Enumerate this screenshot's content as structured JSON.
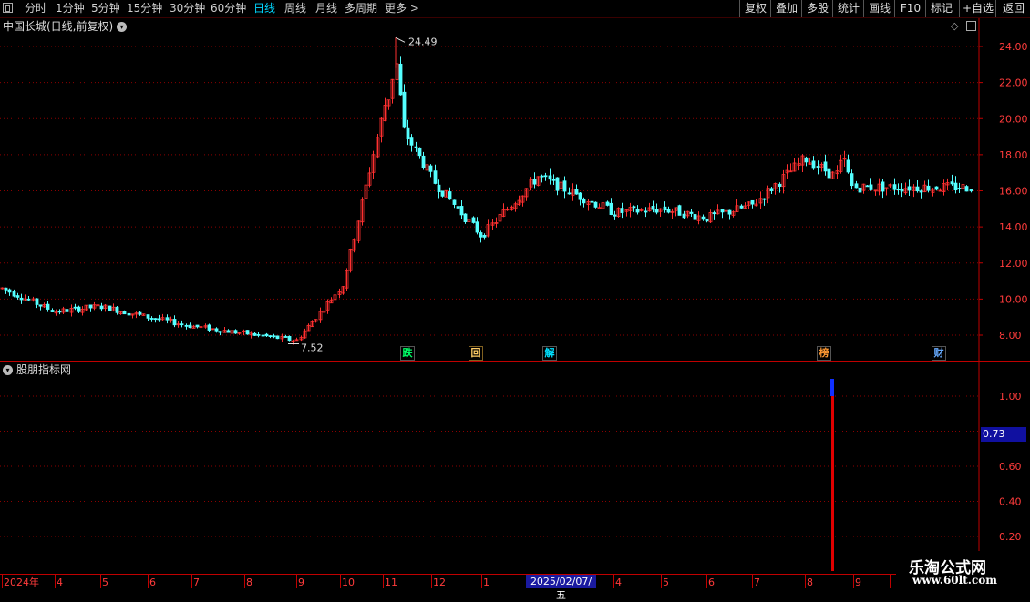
{
  "toolbar": {
    "periods": [
      "分时",
      "1分钟",
      "5分钟",
      "15分钟",
      "30分钟",
      "60分钟",
      "日线",
      "周线",
      "月线",
      "多周期",
      "更多 >"
    ],
    "active_period": "日线",
    "buttons": [
      "复权",
      "叠加",
      "多股",
      "统计",
      "画线",
      "F10",
      "标记",
      "+自选",
      "返回"
    ]
  },
  "main_panel": {
    "title": "中国长城(日线,前复权)",
    "high_label": "24.49",
    "low_label": "7.52",
    "y_ticks": [
      "24.00",
      "22.00",
      "20.00",
      "18.00",
      "16.00",
      "14.00",
      "12.00",
      "10.00",
      "8.00"
    ],
    "signals": [
      {
        "text": "跌",
        "color": "#00ff66",
        "border": "#555"
      },
      {
        "text": "回",
        "color": "#ffcc66",
        "border": "#806020"
      },
      {
        "text": "解",
        "color": "#00e0ff",
        "border": "#555"
      },
      {
        "text": "榜",
        "color": "#ff9933",
        "border": "#555"
      },
      {
        "text": "财",
        "color": "#66aaff",
        "border": "#555"
      }
    ]
  },
  "sub_panel": {
    "title": "股朋指标网",
    "y_ticks": [
      "1.00",
      "0.60",
      "0.40",
      "0.20"
    ],
    "current_value": "0.73"
  },
  "date_axis": {
    "labels": [
      "2024年",
      "4",
      "5",
      "6",
      "7",
      "8",
      "9",
      "10",
      "11",
      "12",
      "1",
      "4",
      "5",
      "6",
      "7",
      "8",
      "9"
    ],
    "highlighted": "2025/02/07/五"
  },
  "colors": {
    "up": "#ff3030",
    "down": "#54ffff",
    "grid": "#8b0000",
    "axis": "#c00000",
    "ma_line": "#ffffff",
    "highlight": "#1a1aa0"
  },
  "watermark": {
    "line1": "乐淘公式网",
    "line2": "www.60lt.com"
  },
  "chart_data": {
    "type": "candlestick",
    "price_points": [
      [
        "2024-03",
        10.6
      ],
      [
        "2024-04",
        9.3
      ],
      [
        "2024-05",
        9.6
      ],
      [
        "2024-06",
        9.0
      ],
      [
        "2024-07",
        8.5
      ],
      [
        "2024-08",
        8.1
      ],
      [
        "2024-09",
        7.7
      ],
      [
        "2024-10",
        10.8
      ],
      [
        "2024-11",
        21.0
      ],
      [
        "2024-12",
        16.5
      ],
      [
        "2025-01",
        13.5
      ],
      [
        "2025-02",
        16.8
      ],
      [
        "2025-04",
        14.8
      ],
      [
        "2025-05",
        15.0
      ],
      [
        "2025-06",
        14.5
      ],
      [
        "2025-07",
        15.2
      ],
      [
        "2025-08",
        17.8
      ],
      [
        "2025-09",
        16.2
      ]
    ],
    "high": 24.49,
    "low": 7.52,
    "ylim": [
      7.0,
      25.0
    ],
    "indicator": {
      "name": "股朋指标网",
      "current": 0.73,
      "signal_value": 1.0,
      "ylim": [
        0,
        1.2
      ]
    }
  }
}
